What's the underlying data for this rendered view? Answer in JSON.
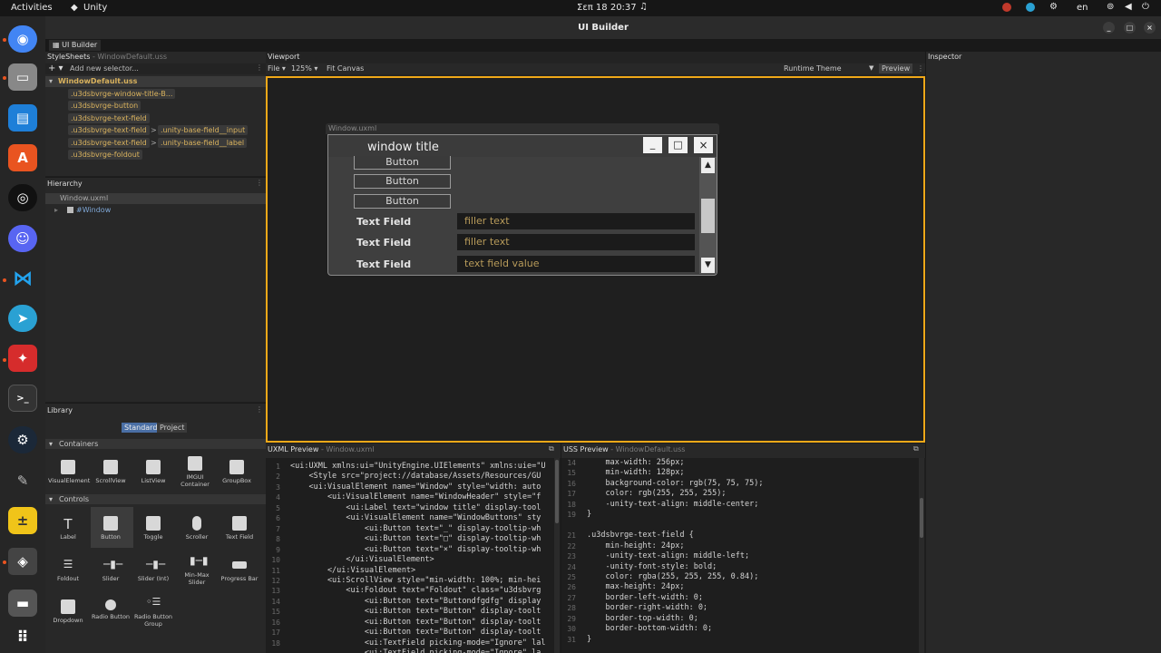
{
  "topbar": {
    "activities": "Activities",
    "app": "Unity",
    "clock": "Σεπ 18  20:37",
    "lang": "en"
  },
  "window": {
    "title": "UI Builder",
    "tab": "UI Builder"
  },
  "stylesheets": {
    "header": "StyleSheets",
    "header_sub": "- WindowDefault.uss",
    "add_selector": "Add new selector...",
    "file": "WindowDefault.uss",
    "selectors": [
      ".u3dsbvrge-window-title-B...",
      ".u3dsbvrge-button",
      ".u3dsbvrge-text-field",
      ".u3dsbvrge-text-field",
      ".u3dsbvrge-text-field",
      ".u3dsbvrge-foldout"
    ],
    "child_selectors": {
      "input": ".unity-base-field__input",
      "label": ".unity-base-field__label",
      "arrow": ">"
    }
  },
  "hierarchy": {
    "header": "Hierarchy",
    "file": "Window.uxml",
    "root": "#Window"
  },
  "library": {
    "header": "Library",
    "tab_standard": "Standard",
    "tab_project": "Project",
    "containers_header": "Containers",
    "controls_header": "Controls",
    "containers": [
      "VisualElement",
      "ScrollView",
      "ListView",
      "IMGUI Container",
      "GroupBox"
    ],
    "controls": [
      "Label",
      "Button",
      "Toggle",
      "Scroller",
      "Text Field",
      "Foldout",
      "Slider",
      "Slider (Int)",
      "Min-Max Slider",
      "Progress Bar",
      "Dropdown",
      "Radio Button",
      "Radio Button Group"
    ]
  },
  "viewport": {
    "header": "Viewport",
    "file_menu": "File",
    "zoom": "125%",
    "fit": "Fit Canvas",
    "theme": "Runtime Theme",
    "preview": "Preview"
  },
  "canvas": {
    "doc_label": "Window.uxml",
    "window_title": "window title",
    "btn_min": "_",
    "btn_max": "□",
    "btn_close": "×",
    "buttons": [
      "Button",
      "Button",
      "Button"
    ],
    "fields": [
      {
        "label": "Text Field",
        "value": "filler text"
      },
      {
        "label": "Text Field",
        "value": "filler text"
      },
      {
        "label": "Text Field",
        "value": "text field value"
      }
    ]
  },
  "inspector": {
    "header": "Inspector"
  },
  "uxml": {
    "header": "UXML Preview",
    "sub": "- Window.uxml",
    "line_numbers": [
      "1",
      "2",
      "3",
      "4",
      "5",
      "6",
      "7",
      "8",
      "9",
      "10",
      "11",
      "12",
      "13",
      "14",
      "15",
      "16",
      "17",
      "18"
    ],
    "lines": [
      "<ui:UXML xmlns:ui=\"UnityEngine.UIElements\" xmlns:uie=\"U",
      "    <Style src=\"project://database/Assets/Resources/GU",
      "    <ui:VisualElement name=\"Window\" style=\"width: auto",
      "        <ui:VisualElement name=\"WindowHeader\" style=\"f",
      "            <ui:Label text=\"window title\" display-tool",
      "            <ui:VisualElement name=\"WindowButtons\" sty",
      "                <ui:Button text=\"_\" display-tooltip-wh",
      "                <ui:Button text=\"□\" display-tooltip-wh",
      "                <ui:Button text=\"×\" display-tooltip-wh",
      "            </ui:VisualElement>",
      "        </ui:VisualElement>",
      "        <ui:ScrollView style=\"min-width: 100%; min-hei",
      "            <ui:Foldout text=\"Foldout\" class=\"u3dsbvrg",
      "                <ui:Button text=\"Buttondfgdfg\" display",
      "                <ui:Button text=\"Button\" display-toolt",
      "                <ui:Button text=\"Button\" display-toolt",
      "                <ui:Button text=\"Button\" display-toolt",
      "                <ui:TextField picking-mode=\"Ignore\" lal",
      "                <ui:TextField picking-mode=\"Ignore\" la"
    ]
  },
  "uss": {
    "header": "USS Preview",
    "sub": "- WindowDefault.uss",
    "line_numbers": [
      "14",
      "15",
      "16",
      "17",
      "18",
      "19",
      "",
      "21",
      "22",
      "23",
      "24",
      "25",
      "26",
      "27",
      "28",
      "29",
      "30",
      "31"
    ],
    "lines": [
      "    max-width: 256px;",
      "    min-width: 128px;",
      "    background-color: rgb(75, 75, 75);",
      "    color: rgb(255, 255, 255);",
      "    -unity-text-align: middle-center;",
      "}",
      "",
      ".u3dsbvrge-text-field {",
      "    min-height: 24px;",
      "    -unity-text-align: middle-left;",
      "    -unity-font-style: bold;",
      "    color: rgba(255, 255, 255, 0.84);",
      "    max-height: 24px;",
      "    border-left-width: 0;",
      "    border-right-width: 0;",
      "    border-top-width: 0;",
      "    border-bottom-width: 0;",
      "}"
    ]
  },
  "colors": {
    "accent": "#f0a818",
    "selector_text": "#d9b25d",
    "ubuntu_orange": "#e95420"
  }
}
